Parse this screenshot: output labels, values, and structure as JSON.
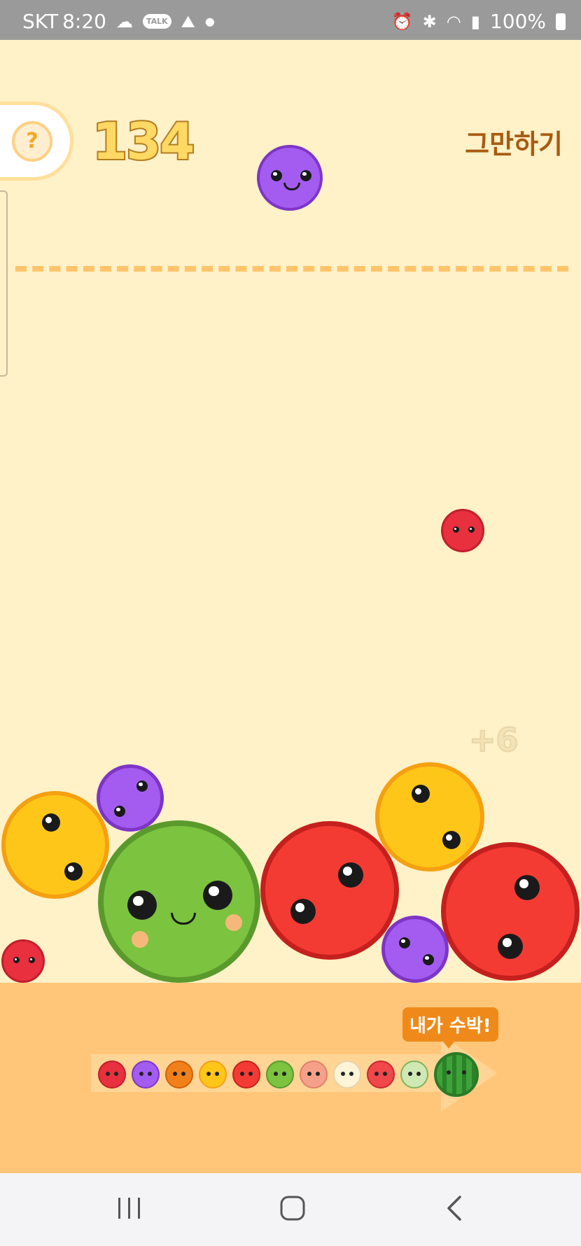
{
  "status_bar": {
    "carrier": "SKT",
    "time": "8:20",
    "battery": "100%",
    "icons": [
      "cloud-icon",
      "talk-icon",
      "app-icon",
      "dot-icon",
      "alarm-icon",
      "bluetooth-icon",
      "wifi-icon",
      "signal-icon",
      "battery-icon"
    ],
    "talk_label": "TALK"
  },
  "game": {
    "score": "134",
    "help_label": "?",
    "quit_label": "그만하기",
    "combo_text": "+6",
    "fruit_colors": {
      "cherry": "#e8303f",
      "grape": "#a45cf0",
      "orange": "#f2801a",
      "lemon": "#ffc61a",
      "apple": "#f43b33",
      "kiwi": "#7cc33f",
      "peach": "#f6a08a",
      "pear": "#fff4d8",
      "tomato": "#f0474b",
      "melon": "#cfe8b4",
      "watermelon": "#2e8a2a"
    }
  },
  "evolution": {
    "tooltip": "내가 수박!",
    "chain": [
      "cherry",
      "grape",
      "orange",
      "lemon",
      "apple",
      "kiwi",
      "peach",
      "pear",
      "tomato",
      "melon",
      "watermelon"
    ]
  },
  "nav": {
    "recent_icon": "recent-apps-icon",
    "home_icon": "home-icon",
    "back_icon": "back-icon"
  }
}
